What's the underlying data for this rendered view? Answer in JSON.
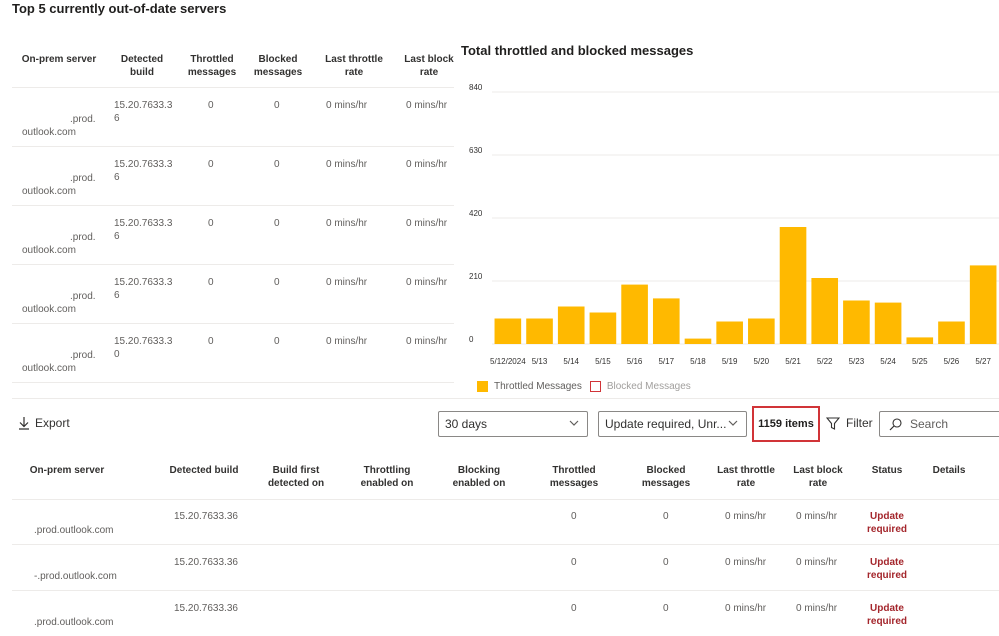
{
  "top_section": {
    "title": "Top 5 currently out-of-date servers",
    "columns": [
      "On-prem server",
      "Detected build",
      "Throttled messages",
      "Blocked messages",
      "Last throttle rate",
      "Last block rate"
    ],
    "rows": [
      {
        "server_line1": ".prod.",
        "server_line2": "outlook.com",
        "build": "15.20.7633.36",
        "throttled": "0",
        "blocked": "0",
        "throttle_rate": "0 mins/hr",
        "block_rate": "0 mins/hr"
      },
      {
        "server_line1": ".prod.",
        "server_line2": "outlook.com",
        "build": "15.20.7633.36",
        "throttled": "0",
        "blocked": "0",
        "throttle_rate": "0 mins/hr",
        "block_rate": "0 mins/hr"
      },
      {
        "server_line1": ".prod.",
        "server_line2": "outlook.com",
        "build": "15.20.7633.36",
        "throttled": "0",
        "blocked": "0",
        "throttle_rate": "0 mins/hr",
        "block_rate": "0 mins/hr"
      },
      {
        "server_line1": ".prod.",
        "server_line2": "outlook.com",
        "build": "15.20.7633.36",
        "throttled": "0",
        "blocked": "0",
        "throttle_rate": "0 mins/hr",
        "block_rate": "0 mins/hr"
      },
      {
        "server_line1": ".prod.",
        "server_line2": "outlook.com",
        "build": "15.20.7633.30",
        "throttled": "0",
        "blocked": "0",
        "throttle_rate": "0 mins/hr",
        "block_rate": "0 mins/hr"
      }
    ]
  },
  "chart_data": {
    "type": "bar",
    "title": "Total throttled and blocked messages",
    "categories": [
      "5/12/2024",
      "5/13",
      "5/14",
      "5/15",
      "5/16",
      "5/17",
      "5/18",
      "5/19",
      "5/20",
      "5/21",
      "5/22",
      "5/23",
      "5/24",
      "5/25",
      "5/26",
      "5/27"
    ],
    "series": [
      {
        "name": "Throttled Messages",
        "color": "#ffb900",
        "values": [
          85,
          85,
          125,
          105,
          198,
          152,
          18,
          75,
          85,
          390,
          220,
          145,
          138,
          22,
          75,
          262
        ]
      },
      {
        "name": "Blocked Messages",
        "color": "#d13438",
        "values": [
          0,
          0,
          0,
          0,
          0,
          0,
          0,
          0,
          0,
          0,
          0,
          0,
          0,
          0,
          0,
          0
        ]
      }
    ],
    "yticks": [
      "0",
      "210",
      "420",
      "630",
      "840"
    ],
    "ylim": [
      0,
      840
    ],
    "grid": true,
    "legend": "bottom-left"
  },
  "toolbar": {
    "export_label": "Export",
    "range_value": "30 days",
    "status_filter_value": "Update required, Unr...",
    "items_count": "1159 items",
    "filter_label": "Filter",
    "search_placeholder": "Search"
  },
  "main_table": {
    "columns": [
      "On-prem server",
      "Detected build",
      "Build first detected on",
      "Throttling enabled on",
      "Blocking enabled on",
      "Throttled messages",
      "Blocked messages",
      "Last throttle rate",
      "Last block rate",
      "Status",
      "Details"
    ],
    "rows": [
      {
        "server": ".prod.outlook.com",
        "build": "15.20.7633.36",
        "throttled": "0",
        "blocked": "0",
        "throttle_rate": "0 mins/hr",
        "block_rate": "0 mins/hr",
        "status": "Update required"
      },
      {
        "server": "-.prod.outlook.com",
        "build": "15.20.7633.36",
        "throttled": "0",
        "blocked": "0",
        "throttle_rate": "0 mins/hr",
        "block_rate": "0 mins/hr",
        "status": "Update required"
      },
      {
        "server": ".prod.outlook.com",
        "build": "15.20.7633.36",
        "throttled": "0",
        "blocked": "0",
        "throttle_rate": "0 mins/hr",
        "block_rate": "0 mins/hr",
        "status": "Update required"
      }
    ]
  }
}
